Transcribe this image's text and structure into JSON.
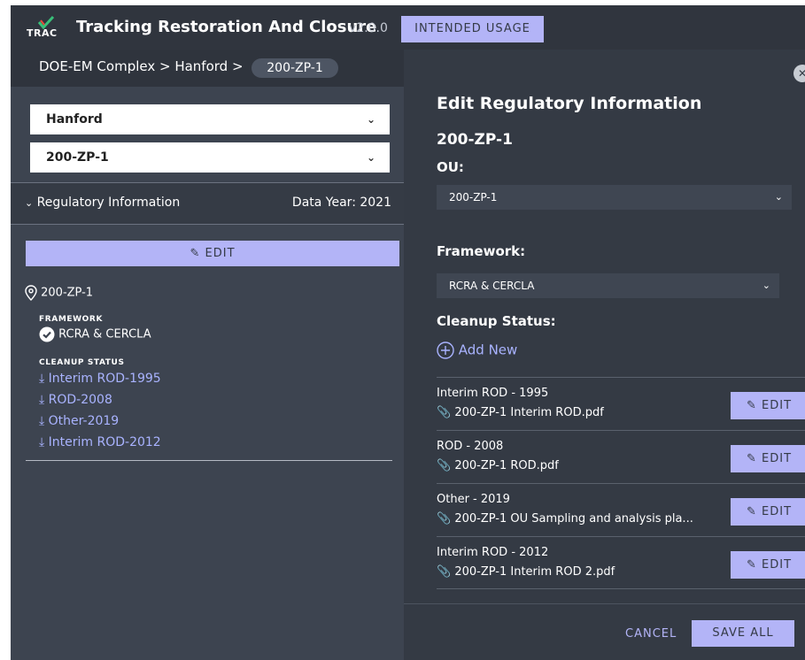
{
  "header": {
    "logo_text": "TRAC",
    "title": "Tracking Restoration And Closure",
    "version": "v2.0.0",
    "intended_usage_label": "INTENDED USAGE"
  },
  "breadcrumb": {
    "path": "DOE-EM Complex > Hanford >",
    "current": "200-ZP-1"
  },
  "selectors": {
    "site": "Hanford",
    "ou": "200-ZP-1"
  },
  "regulatory": {
    "section_title": "Regulatory Information",
    "data_year": "Data Year: 2021",
    "edit_label": "EDIT",
    "ou_name": "200-ZP-1",
    "framework_heading": "FRAMEWORK",
    "framework_value": "RCRA & CERCLA",
    "cleanup_heading": "CLEANUP STATUS",
    "cleanup_items": [
      "Interim ROD-1995",
      "ROD-2008",
      "Other-2019",
      "Interim ROD-2012"
    ]
  },
  "editor": {
    "title": "Edit Regulatory Information",
    "subtitle": "200-ZP-1",
    "ou_label": "OU:",
    "ou_value": "200-ZP-1",
    "framework_label": "Framework:",
    "framework_value": "RCRA & CERCLA",
    "cleanup_label": "Cleanup Status:",
    "add_new_label": "Add New",
    "documents": [
      {
        "title": "Interim ROD - 1995",
        "file": "200-ZP-1 Interim ROD.pdf",
        "edit": "EDIT"
      },
      {
        "title": "ROD - 2008",
        "file": "200-ZP-1 ROD.pdf",
        "edit": "EDIT"
      },
      {
        "title": "Other - 2019",
        "file": "200-ZP-1 OU Sampling and analysis pla...",
        "edit": "EDIT"
      },
      {
        "title": "Interim ROD - 2012",
        "file": "200-ZP-1 Interim ROD 2.pdf",
        "edit": "EDIT"
      }
    ],
    "cancel_label": "CANCEL",
    "save_label": "SAVE ALL"
  },
  "colors": {
    "accent": "#b3b4f7",
    "link": "#a9b3ff",
    "panel": "#3d4450",
    "header": "#30353e"
  }
}
